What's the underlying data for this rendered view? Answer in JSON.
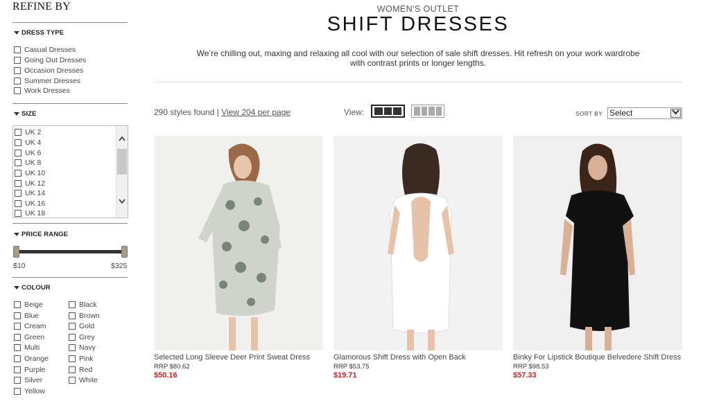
{
  "sidebar": {
    "title": "REFINE BY",
    "dress_type": {
      "title": "DRESS TYPE",
      "options": [
        "Casual Dresses",
        "Going Out Dresses",
        "Occasion Dresses",
        "Summer Dresses",
        "Work Dresses"
      ]
    },
    "size": {
      "title": "SIZE",
      "options": [
        "UK 2",
        "UK 4",
        "UK 6",
        "UK 8",
        "UK 10",
        "UK 12",
        "UK 14",
        "UK 16",
        "UK 18"
      ]
    },
    "price": {
      "title": "PRICE RANGE",
      "min_label": "$10",
      "max_label": "$325"
    },
    "colour": {
      "title": "COLOUR",
      "col1": [
        "Beige",
        "Blue",
        "Cream",
        "Green",
        "Multi",
        "Orange",
        "Purple",
        "Silver",
        "Yellow"
      ],
      "col2": [
        "Black",
        "Brown",
        "Gold",
        "Grey",
        "Navy",
        "Pink",
        "Red",
        "White"
      ]
    }
  },
  "header": {
    "section": "WOMEN'S OUTLET",
    "title": "SHIFT DRESSES",
    "intro": "We’re chilling out, maxing and relaxing all cool with our selection of sale shift dresses. Hit refresh on your work wardrobe with contrast prints or longer lengths."
  },
  "toolbar": {
    "count_text": "290 styles found |",
    "view_per_page": "View 204 per page",
    "view_label": "View:",
    "sort_label": "SORT BY",
    "sort_value": "Select"
  },
  "products": [
    {
      "name": "Selected Long Sleeve Deer Print Sweat Dress",
      "rrp": "RRP $80.62",
      "price": "$50.16"
    },
    {
      "name": "Glamorous Shift Dress with Open Back",
      "rrp": "RRP $53.75",
      "price": "$19.71"
    },
    {
      "name": "Binky For Lipstick Boutique Belvedere Shift Dress",
      "rrp": "RRP $98.53",
      "price": "$57.33"
    }
  ],
  "colors": {
    "sale_price": "#d21f1f",
    "rule": "#888888"
  }
}
